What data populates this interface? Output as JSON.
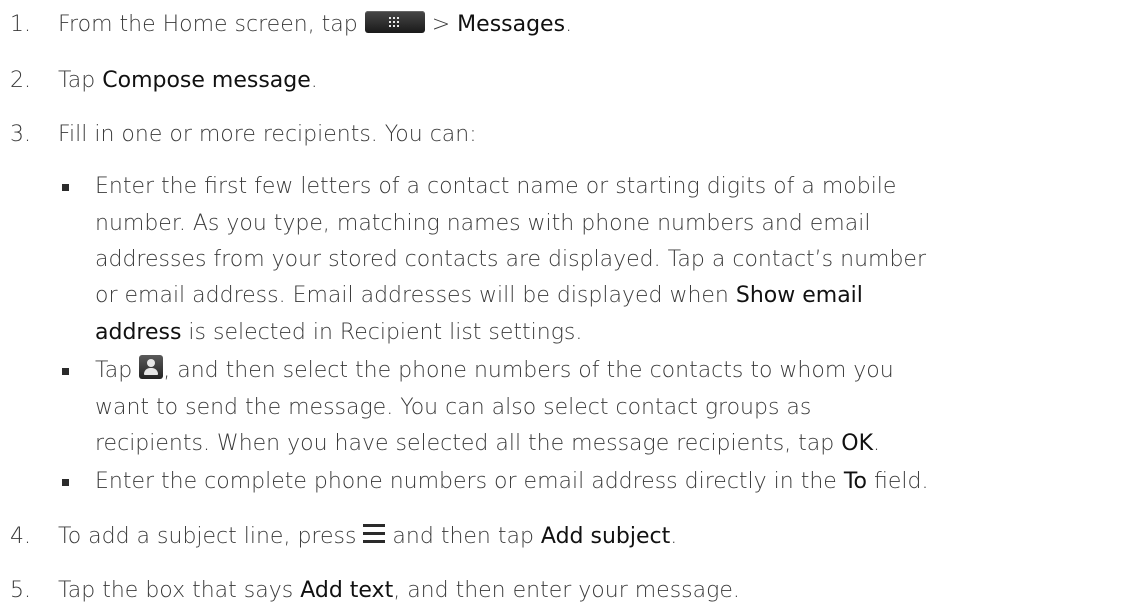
{
  "steps": {
    "s1": {
      "num": "1.",
      "pre": "From the Home screen, tap",
      "post": " > ",
      "link": "Messages",
      "end": "."
    },
    "s2": {
      "num": "2.",
      "pre": "Tap ",
      "link": "Compose message",
      "end": "."
    },
    "s3": {
      "num": "3.",
      "text": "Fill in one or more recipients. You can:"
    },
    "b1": {
      "l1": "Enter the first few letters of a contact name or starting digits of a mobile",
      "l2": "number. As you type, matching names with phone numbers and email",
      "l3": "addresses from your stored contacts are displayed. Tap a contact’s number",
      "l4_pre": "or email address. Email addresses will be displayed when ",
      "l4_link": "Show email",
      "l5_link": "address",
      "l5_post": " is selected in Recipient list settings."
    },
    "b2": {
      "l1_pre": "Tap ",
      "l1_post": ", and then select the phone numbers of the contacts to whom you",
      "l2": "want to send the message. You can also select contact groups as",
      "l3_pre": "recipients. When you have selected all the message recipients, tap ",
      "l3_link": "OK",
      "l3_end": "."
    },
    "b3": {
      "pre": "Enter the complete phone numbers or email address directly in the ",
      "link": "To",
      "post": " field."
    },
    "s4": {
      "num": "4.",
      "pre": "To add a subject line, press ",
      "mid": " and then tap ",
      "link": "Add subject",
      "end": "."
    },
    "s5": {
      "num": "5.",
      "pre": "Tap the box that says ",
      "link": "Add text",
      "post": ", and then enter your message."
    }
  },
  "icons": {
    "apps": "apps-grid-icon",
    "people": "people-icon",
    "menu": "menu-icon"
  },
  "colors": {
    "text": "#3a3a3a",
    "emphasis": "#111111",
    "watermark": "#c8c8c8"
  }
}
